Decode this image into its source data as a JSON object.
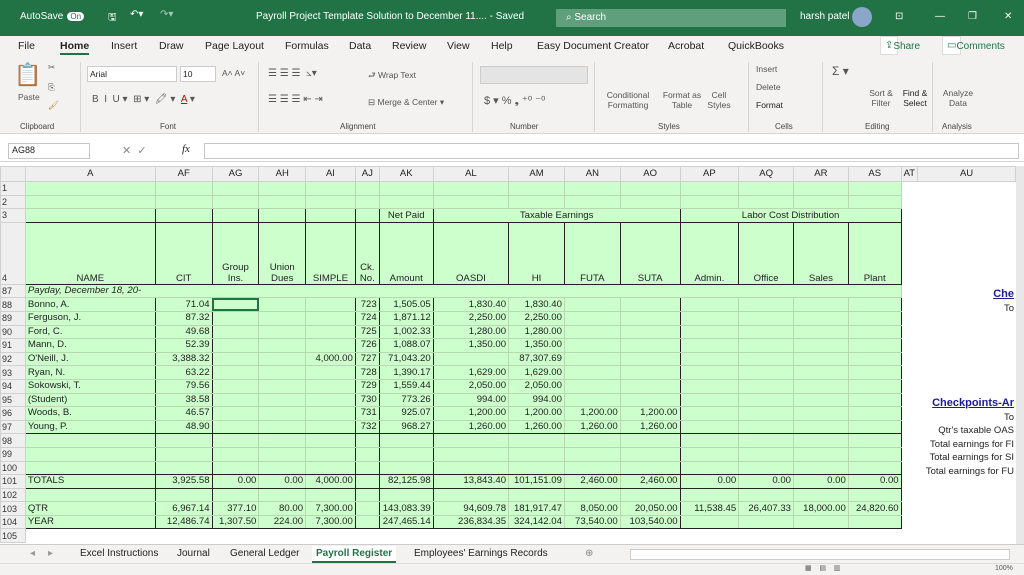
{
  "titlebar": {
    "autosave": "AutoSave",
    "autosave_state": "On",
    "doc_title": "Payroll Project Template Solution to December 11....  -  Saved",
    "search": "Search",
    "user": "harsh patel"
  },
  "menu": {
    "tabs": [
      "File",
      "Home",
      "Insert",
      "Draw",
      "Page Layout",
      "Formulas",
      "Data",
      "Review",
      "View",
      "Help",
      "Easy Document Creator",
      "Acrobat",
      "QuickBooks"
    ],
    "share": "Share",
    "comments": "Comments"
  },
  "ribbon": {
    "paste": "Paste",
    "font_name": "Arial",
    "font_size": "10",
    "wrap_text": "Wrap Text",
    "merge_center": "Merge & Center",
    "conditional": "Conditional Formatting",
    "format_table": "Format as Table",
    "cell_styles": "Cell Styles",
    "insert": "Insert",
    "delete": "Delete",
    "format": "Format",
    "sort_filter": "Sort & Filter",
    "find_select": "Find & Select",
    "analyze": "Analyze Data",
    "groups": [
      "Clipboard",
      "Font",
      "Alignment",
      "Number",
      "Styles",
      "Cells",
      "Editing",
      "Analysis"
    ]
  },
  "formula_bar": {
    "name_box": "AG88",
    "fx": "fx",
    "value": ""
  },
  "columns": [
    "A",
    "AF",
    "AG",
    "AH",
    "AI",
    "AJ",
    "AK",
    "AL",
    "AM",
    "AN",
    "AO",
    "AP",
    "AQ",
    "AR",
    "AS",
    "AT",
    "AU"
  ],
  "group_headers": {
    "net_paid": "Net Paid",
    "taxable": "Taxable Earnings",
    "labor": "Labor Cost Distribution"
  },
  "headers": [
    "NAME",
    "CIT",
    "Group Ins.",
    "Union Dues",
    "SIMPLE",
    "Ck. No.",
    "Amount",
    "OASDI",
    "HI",
    "FUTA",
    "SUTA",
    "Admin.",
    "Office",
    "Sales",
    "Plant"
  ],
  "payday": "Payday, December 18, 20-",
  "rows": [
    {
      "r": "88",
      "c": [
        "Bonno, A.",
        "71.04",
        "",
        "",
        "",
        "723",
        "1,505.05",
        "1,830.40",
        "1,830.40",
        "",
        "",
        "",
        "",
        "",
        ""
      ]
    },
    {
      "r": "89",
      "c": [
        "Ferguson, J.",
        "87.32",
        "",
        "",
        "",
        "724",
        "1,871.12",
        "2,250.00",
        "2,250.00",
        "",
        "",
        "",
        "",
        "",
        ""
      ]
    },
    {
      "r": "90",
      "c": [
        "Ford, C.",
        "49.68",
        "",
        "",
        "",
        "725",
        "1,002.33",
        "1,280.00",
        "1,280.00",
        "",
        "",
        "",
        "",
        "",
        ""
      ]
    },
    {
      "r": "91",
      "c": [
        "Mann, D.",
        "52.39",
        "",
        "",
        "",
        "726",
        "1,088.07",
        "1,350.00",
        "1,350.00",
        "",
        "",
        "",
        "",
        "",
        ""
      ]
    },
    {
      "r": "92",
      "c": [
        "O'Neill, J.",
        "3,388.32",
        "",
        "",
        "4,000.00",
        "727",
        "71,043.20",
        "",
        "87,307.69",
        "",
        "",
        "",
        "",
        "",
        ""
      ]
    },
    {
      "r": "93",
      "c": [
        "Ryan, N.",
        "63.22",
        "",
        "",
        "",
        "728",
        "1,390.17",
        "1,629.00",
        "1,629.00",
        "",
        "",
        "",
        "",
        "",
        ""
      ]
    },
    {
      "r": "94",
      "c": [
        "Sokowski, T.",
        "79.56",
        "",
        "",
        "",
        "729",
        "1,559.44",
        "2,050.00",
        "2,050.00",
        "",
        "",
        "",
        "",
        "",
        ""
      ]
    },
    {
      "r": "95",
      "c": [
        "(Student)",
        "38.58",
        "",
        "",
        "",
        "730",
        "773.26",
        "994.00",
        "994.00",
        "",
        "",
        "",
        "",
        "",
        ""
      ]
    },
    {
      "r": "96",
      "c": [
        "Woods, B.",
        "46.57",
        "",
        "",
        "",
        "731",
        "925.07",
        "1,200.00",
        "1,200.00",
        "1,200.00",
        "1,200.00",
        "",
        "",
        "",
        ""
      ]
    },
    {
      "r": "97",
      "c": [
        "Young, P.",
        "48.90",
        "",
        "",
        "",
        "732",
        "968.27",
        "1,260.00",
        "1,260.00",
        "1,260.00",
        "1,260.00",
        "",
        "",
        "",
        ""
      ]
    },
    {
      "r": "98",
      "c": [
        "",
        "",
        "",
        "",
        "",
        "",
        "",
        "",
        "",
        "",
        "",
        "",
        "",
        "",
        ""
      ]
    },
    {
      "r": "99",
      "c": [
        "",
        "",
        "",
        "",
        "",
        "",
        "",
        "",
        "",
        "",
        "",
        "",
        "",
        "",
        ""
      ]
    },
    {
      "r": "100",
      "c": [
        "",
        "",
        "",
        "",
        "",
        "",
        "",
        "",
        "",
        "",
        "",
        "",
        "",
        "",
        ""
      ]
    },
    {
      "r": "101",
      "c": [
        "   TOTALS",
        "3,925.58",
        "0.00",
        "0.00",
        "4,000.00",
        "",
        "82,125.98",
        "13,843.40",
        "101,151.09",
        "2,460.00",
        "2,460.00",
        "0.00",
        "0.00",
        "0.00",
        "0.00"
      ]
    },
    {
      "r": "102",
      "c": [
        "",
        "",
        "",
        "",
        "",
        "",
        "",
        "",
        "",
        "",
        "",
        "",
        "",
        "",
        ""
      ]
    },
    {
      "r": "103",
      "c": [
        "QTR",
        "6,967.14",
        "377.10",
        "80.00",
        "7,300.00",
        "",
        "143,083.39",
        "94,609.78",
        "181,917.47",
        "8,050.00",
        "20,050.00",
        "11,538.45",
        "26,407.33",
        "18,000.00",
        "24,820.60"
      ]
    },
    {
      "r": "104",
      "c": [
        "YEAR",
        "12,486.74",
        "1,307.50",
        "224.00",
        "7,300.00",
        "",
        "247,465.14",
        "236,834.35",
        "324,142.04",
        "73,540.00",
        "103,540.00",
        "",
        "",
        "",
        ""
      ]
    }
  ],
  "right_panel": {
    "che": "Che",
    "tot1": "To",
    "checkpoints": "Checkpoints-Ar",
    "tot2": "To",
    "qtr_oasdi": "Qtr's taxable OAS",
    "fi": "Total earnings for FI",
    "si": "Total earnings for SI",
    "fu": "Total earnings for FU"
  },
  "sheets": [
    "Excel Instructions",
    "Journal",
    "General Ledger",
    "Payroll Register",
    "Employees' Earnings Records"
  ],
  "active_sheet": "Payroll Register",
  "zoom": "100%"
}
